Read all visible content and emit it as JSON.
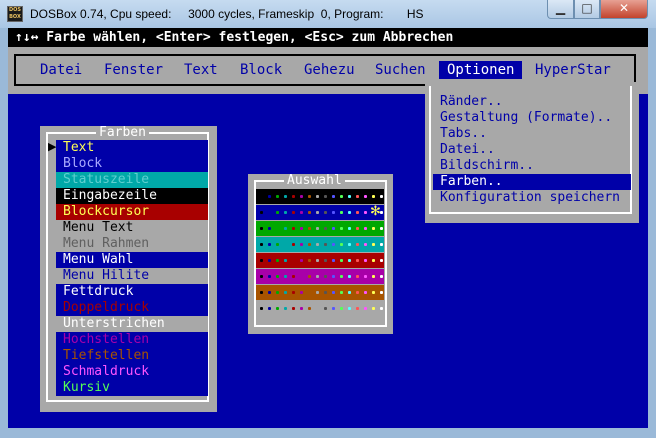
{
  "window": {
    "title": "DOSBox 0.74, Cpu speed:     3000 cycles, Frameskip  0, Program:       HS",
    "icon_text": "DOS BOX",
    "buttons": {
      "minimize": "▁",
      "maximize": "□",
      "close": "✕"
    }
  },
  "hint": "↑↓↔ Farbe wählen, <Enter> festlegen, <Esc> zum Abbrechen",
  "menu": {
    "items": [
      {
        "label": "Datei"
      },
      {
        "label": "Fenster"
      },
      {
        "label": "Text"
      },
      {
        "label": "Block"
      },
      {
        "label": "Gehezu"
      },
      {
        "label": "Suchen"
      },
      {
        "label": "Optionen",
        "active": true
      },
      {
        "label": "HyperStar"
      }
    ]
  },
  "dropdown": {
    "items": [
      {
        "label": "Ränder.."
      },
      {
        "label": "Gestaltung (Formate).."
      },
      {
        "label": "Tabs.."
      },
      {
        "label": "Datei.."
      },
      {
        "label": "Bildschirm.."
      },
      {
        "label": "Farben..",
        "selected": true
      },
      {
        "label": "Konfiguration speichern"
      }
    ]
  },
  "farben": {
    "title": "Farben",
    "cursor": "▶",
    "items": [
      {
        "label": "Text",
        "fg": "#ffff55",
        "bg": "#0000a8"
      },
      {
        "label": "Block",
        "fg": "#aaaaff",
        "bg": "#0000a8"
      },
      {
        "label": "Statuszeile",
        "fg": "#5fcfcf",
        "bg": "#00a8a8"
      },
      {
        "label": "Eingabezeile",
        "fg": "#ffffff",
        "bg": "#000000"
      },
      {
        "label": "Blockcursor",
        "fg": "#ffff55",
        "bg": "#a80000"
      },
      {
        "label": "Menu Text",
        "fg": "#000000",
        "bg": "#a8a8a8"
      },
      {
        "label": "Menu Rahmen",
        "fg": "#606060",
        "bg": "#a8a8a8"
      },
      {
        "label": "Menu Wahl",
        "fg": "#ffffff",
        "bg": "#0000a8"
      },
      {
        "label": "Menu Hilite",
        "fg": "#0000a8",
        "bg": "#a8a8a8"
      },
      {
        "label": "Fettdruck",
        "fg": "#ffffff",
        "bg": "#0000a8"
      },
      {
        "label": "Doppeldruck",
        "fg": "#a80000",
        "bg": "#0000a8"
      },
      {
        "label": "Unterstrichen",
        "fg": "#ffffff",
        "bg": "#a8a8a8"
      },
      {
        "label": "Hochstellen",
        "fg": "#a800a8",
        "bg": "#0000a8"
      },
      {
        "label": "Tiefstellen",
        "fg": "#a85400",
        "bg": "#0000a8"
      },
      {
        "label": "Schmaldruck",
        "fg": "#ff55ff",
        "bg": "#0000a8"
      },
      {
        "label": "Kursiv",
        "fg": "#55ff55",
        "bg": "#0000a8"
      }
    ]
  },
  "auswahl": {
    "title": "Auswahl",
    "selected_glyph": "✻",
    "row_backgrounds": [
      "#000000",
      "#0000a8",
      "#00a800",
      "#00a8a8",
      "#a80000",
      "#a800a8",
      "#a85400",
      "#a8a8a8"
    ],
    "dot_colors": [
      "#000000",
      "#0000a8",
      "#00a800",
      "#00a8a8",
      "#a80000",
      "#a800a8",
      "#a85400",
      "#a8a8a8",
      "#555555",
      "#5555ff",
      "#55ff55",
      "#55ffff",
      "#ff5555",
      "#ff55ff",
      "#ffff55",
      "#ffffff"
    ],
    "selected": {
      "row": 1,
      "col": 14
    }
  }
}
